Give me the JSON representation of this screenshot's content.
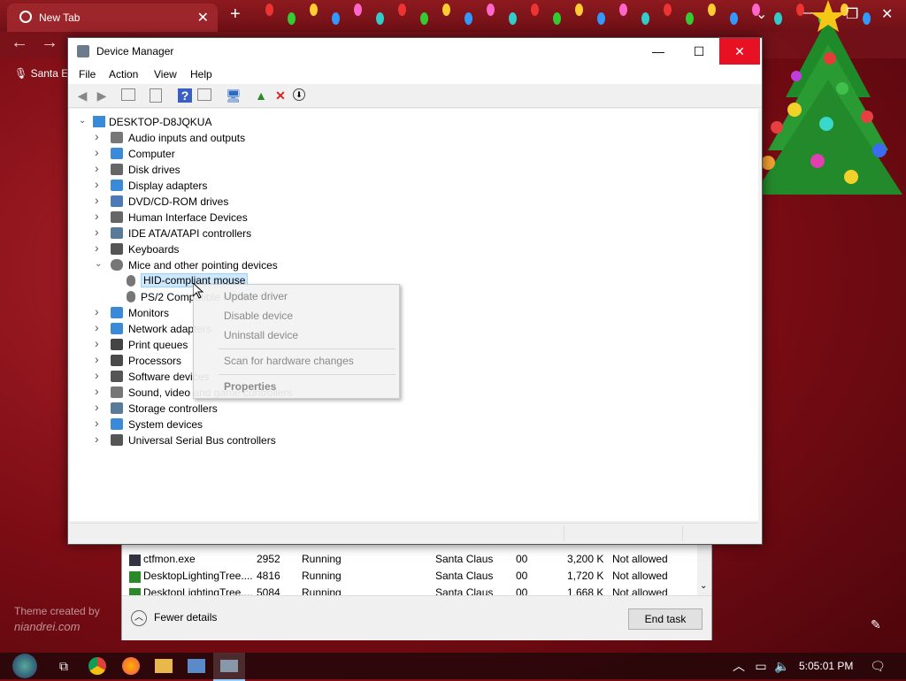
{
  "browser": {
    "tab_title": "New Tab",
    "tab_close": "✕",
    "new_tab": "+",
    "bookmark": "Santa E",
    "theme_credit_line1": "Theme created by",
    "theme_credit_line2": "niandrei.com"
  },
  "device_manager": {
    "title": "Device Manager",
    "menu": [
      "File",
      "Action",
      "View",
      "Help"
    ],
    "root": "DESKTOP-D8JQKUA",
    "categories": [
      {
        "label": "Audio inputs and outputs",
        "icon": "speaker-icon",
        "expanded": false
      },
      {
        "label": "Computer",
        "icon": "monitor-icon",
        "expanded": false
      },
      {
        "label": "Disk drives",
        "icon": "disk-icon",
        "expanded": false
      },
      {
        "label": "Display adapters",
        "icon": "display-adapter-icon",
        "expanded": false
      },
      {
        "label": "DVD/CD-ROM drives",
        "icon": "dvd-icon",
        "expanded": false
      },
      {
        "label": "Human Interface Devices",
        "icon": "hid-icon",
        "expanded": false
      },
      {
        "label": "IDE ATA/ATAPI controllers",
        "icon": "ide-icon",
        "expanded": false
      },
      {
        "label": "Keyboards",
        "icon": "keyboard-icon",
        "expanded": false
      },
      {
        "label": "Mice and other pointing devices",
        "icon": "mouse-icon",
        "expanded": true
      },
      {
        "label": "Monitors",
        "icon": "monitor-icon",
        "expanded": false
      },
      {
        "label": "Network adapters",
        "icon": "network-icon",
        "expanded": false
      },
      {
        "label": "Print queues",
        "icon": "printer-icon",
        "expanded": false
      },
      {
        "label": "Processors",
        "icon": "processor-icon",
        "expanded": false
      },
      {
        "label": "Software devices",
        "icon": "software-device-icon",
        "expanded": false
      },
      {
        "label": "Sound, video and game controllers",
        "icon": "speaker-icon",
        "expanded": false
      },
      {
        "label": "Storage controllers",
        "icon": "storage-icon",
        "expanded": false
      },
      {
        "label": "System devices",
        "icon": "system-icon",
        "expanded": false
      },
      {
        "label": "Universal Serial Bus controllers",
        "icon": "usb-icon",
        "expanded": false
      }
    ],
    "mice_children": [
      "HID-compliant mouse",
      "PS/2 Compatible Mouse"
    ],
    "selected": "HID-compliant mouse"
  },
  "context_menu": {
    "items": [
      "Update driver",
      "Disable device",
      "Uninstall device",
      "Scan for hardware changes",
      "Properties"
    ]
  },
  "task_manager": {
    "rows": [
      {
        "name": "ctfmon.exe",
        "pid": "2952",
        "status": "Running",
        "user": "Santa Claus",
        "cpu": "00",
        "mem": "3,200 K",
        "uac": "Not allowed"
      },
      {
        "name": "DesktopLightingTree....",
        "pid": "4816",
        "status": "Running",
        "user": "Santa Claus",
        "cpu": "00",
        "mem": "1,720 K",
        "uac": "Not allowed"
      },
      {
        "name": "DesktopLightingTree....",
        "pid": "5084",
        "status": "Running",
        "user": "Santa Claus",
        "cpu": "00",
        "mem": "1,668 K",
        "uac": "Not allowed"
      }
    ],
    "fewer_details": "Fewer details",
    "end_task": "End task"
  },
  "taskbar": {
    "clock": "5:05:01 PM"
  },
  "colors": {
    "accent": "#e81123",
    "selection": "#cce8ff",
    "background": "#8a1118"
  }
}
